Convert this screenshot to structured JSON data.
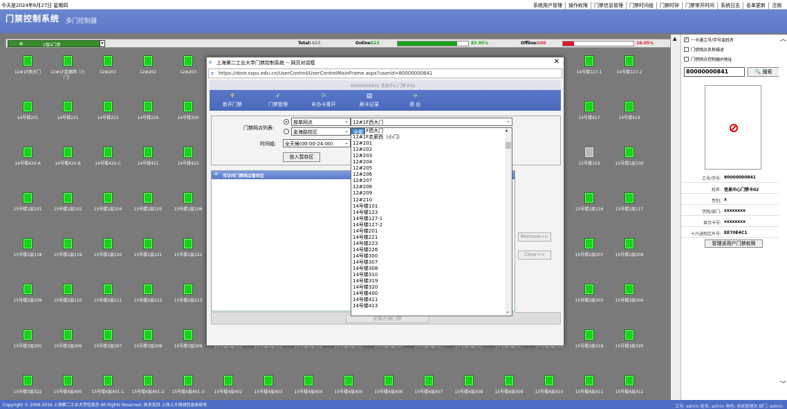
{
  "topbar": {
    "date": "今天是2024年6月27日 星期四",
    "menu": [
      "系统用户管理",
      "操作权限",
      "门禁信息管理",
      "门禁时间组",
      "门禁时钟",
      "门禁常开时间",
      "系统日志",
      "名单更新",
      "注销"
    ]
  },
  "banner": {
    "title": "门禁控制系统",
    "subtitle": "多门控制器"
  },
  "status": {
    "group": "1楼4门禁",
    "total_label": "Total:",
    "total": "623",
    "online_label": "Online:",
    "online": "523",
    "online_pct": "83.95%",
    "online_frac": 0.8395,
    "offline_label": "Offline:",
    "offline": "100",
    "offline_pct": "16.05%",
    "offline_frac": 0.1605,
    "online_color": "#1aa21a",
    "offline_color": "#e0162b"
  },
  "doors": [
    [
      "12#1F西大门",
      "12#1F走廊西（小门）",
      "12#201",
      "12#202",
      "12#203",
      "",
      "",
      "",
      "",
      "",
      "",
      "",
      "",
      "",
      "14号楼127-1",
      "14号楼127-2"
    ],
    [
      "14号楼201",
      "14号楼221",
      "14号楼223",
      "14号楼226",
      "14号楼300",
      "",
      "",
      "",
      "",
      "",
      "",
      "",
      "",
      "",
      "14号楼417",
      "14号楼419"
    ],
    [
      "14号楼420-A",
      "14号楼420-B",
      "14号楼420-C",
      "14号楼421",
      "14号楼422",
      "",
      "",
      "",
      "",
      "",
      "",
      "",
      "",
      "",
      "15号楼103",
      "15号楼1层100"
    ],
    [
      "15号楼1层101",
      "15号楼1层102",
      "15号楼1层104",
      "15号楼1层105",
      "15号楼1层106",
      "",
      "",
      "",
      "",
      "",
      "",
      "",
      "",
      "",
      "15号楼1层116",
      "15号楼1层117"
    ],
    [
      "15号楼1层118",
      "15号楼1层119",
      "15号楼1层120",
      "15号楼1层121",
      "15号楼1层122",
      "",
      "",
      "",
      "",
      "",
      "",
      "",
      "",
      "",
      "15号楼2层207",
      "15号楼2层208"
    ],
    [
      "15号楼2层209",
      "15号楼2层210",
      "15号楼2层211",
      "15号楼2层212",
      "15号楼2层213",
      "",
      "",
      "",
      "",
      "",
      "",
      "",
      "",
      "",
      "15号楼3层303",
      "15号楼3层304"
    ],
    [
      "15号楼3层305",
      "15号楼3层306",
      "15号楼3层307",
      "15号楼3层308",
      "15号楼3层309",
      "15号楼3层310",
      "15号楼3层311",
      "15号楼3层312",
      "15号楼3层313",
      "15号楼3层314",
      "15号楼3层315",
      "15号楼3层316",
      "15号楼3层317",
      "15号楼3层318",
      "15号楼3层319",
      "15号楼3层320"
    ],
    [
      "15号楼3层322",
      "15号楼4层400",
      "15号楼4层401-1",
      "15号楼4层401-2",
      "15号楼4层401-3",
      "15号楼4层402",
      "15号楼4层403",
      "15号楼4层404",
      "15号楼4层405",
      "15号楼4层406",
      "15号楼4层407",
      "15号楼4层408",
      "15号楼4层409",
      "15号楼4层410",
      "15号楼4层411",
      "15号楼4层412"
    ]
  ],
  "offline_doors": [
    "15号楼103"
  ],
  "right": {
    "checks": [
      {
        "label": "一卡通工号/学号或姓名",
        "checked": true
      },
      {
        "label": "门禁网点名称描述",
        "checked": false
      },
      {
        "label": "门禁网点控制器IP地址",
        "checked": false
      }
    ],
    "search_value": "80000000841",
    "search_label": "搜索",
    "info": [
      {
        "k": "工号/学号:",
        "v": "80000000841"
      },
      {
        "k": "姓名:",
        "v": "信息中心门禁卡02"
      },
      {
        "k": "性别:",
        "v": "x"
      },
      {
        "k": "学院/部门:",
        "v": "xxxxxxxx"
      },
      {
        "k": "显示卡号:",
        "v": "xxxxxxxx"
      },
      {
        "k": "十六进制芯片号:",
        "v": "EE70E4C1"
      }
    ],
    "perm_button": "管理该用户门禁权限"
  },
  "footer": {
    "copyright": "Copyright © 2006-2016  上海第二工业大学信息办 All Rights Reserved.    技术支持 上海上大海润信息系统有",
    "right": "工号: admin   姓名: admin   角色: 系统管理员   部门: admin"
  },
  "dialog": {
    "title": "上海第二工业大学门禁控制系统 -- 网页对话框",
    "close": "✕",
    "url": "https://door.sspu.edu.cn/UserControl/UserControlMainFrame.aspx?userid=80000000841",
    "sub": "80000000841   信息中心门禁卡02",
    "toolbar": [
      "新开门禁",
      "门禁管理",
      "补办卡重开",
      "刷卡记录",
      "退   出"
    ],
    "form": {
      "point_label": "门禁网点列表:",
      "radio1": "按单网点",
      "radio2": "金海路校区",
      "point_value": "12#1F西大门",
      "time_label": "时间组:",
      "time_value": "全天候(00:00-24:00)",
      "add_button": "放入暂存区"
    },
    "list_header": "可访问门禁网点暂存区",
    "remove_button": "Remove>>",
    "clear_button": "Clear>>",
    "open_all": "全部开通门禁"
  },
  "dropdown": {
    "selected": "全部",
    "options": [
      "全部",
      "12#1F西大门",
      "12#1F走廊西（小门）",
      "12#201",
      "12#202",
      "12#203",
      "12#204",
      "12#205",
      "12#206",
      "12#207",
      "12#208",
      "12#209",
      "12#210",
      "14号楼101",
      "14号楼123",
      "14号楼127-1",
      "14号楼127-2",
      "14号楼201",
      "14号楼221",
      "14号楼223",
      "14号楼226",
      "14号楼300",
      "14号楼307",
      "14号楼308",
      "14号楼310",
      "14号楼319",
      "14号楼320",
      "14号楼400",
      "14号楼411",
      "14号楼413"
    ]
  }
}
